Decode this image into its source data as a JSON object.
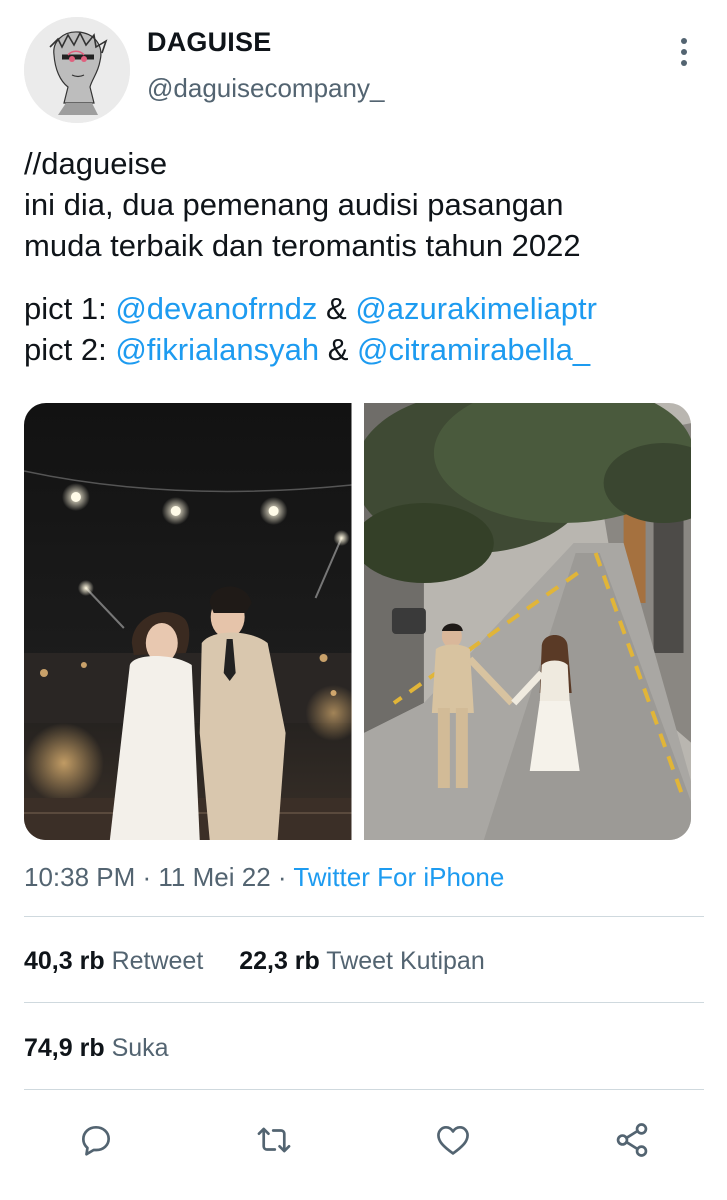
{
  "profile": {
    "display_name": "DAGUISE",
    "handle": "@daguisecompany_",
    "avatar_icon": "statue-head-avatar",
    "more_icon": "more-vertical-icon"
  },
  "tweet": {
    "line1": "//dagueise",
    "line2": "ini dia, dua pemenang audisi pasangan",
    "line3": "muda terbaik dan teromantis tahun 2022",
    "pict1_prefix": "pict 1: ",
    "pict1_mention_a": "@devanofrndz",
    "pict1_amp": " & ",
    "pict1_mention_b": "@azurakimeliaptr",
    "pict2_prefix": "pict 2: ",
    "pict2_mention_a": "@fikrialansyah",
    "pict2_amp": " & ",
    "pict2_mention_b": "@citramirabella_"
  },
  "meta": {
    "time": "10:38 PM",
    "sep1": " · ",
    "date": "11 Mei 22",
    "sep2": " · ",
    "source": "Twitter For iPhone"
  },
  "stats": {
    "retweets_count": "40,3 rb",
    "retweets_label": "Retweet",
    "quotes_count": "22,3 rb",
    "quotes_label": "Tweet Kutipan",
    "likes_count": "74,9 rb",
    "likes_label": "Suka"
  },
  "actions": {
    "reply_icon": "reply-icon",
    "retweet_icon": "retweet-icon",
    "like_icon": "heart-icon",
    "share_icon": "share-icon"
  },
  "colors": {
    "link": "#1d9bf0",
    "secondary_text": "#536471",
    "divider": "#cfd9de"
  }
}
